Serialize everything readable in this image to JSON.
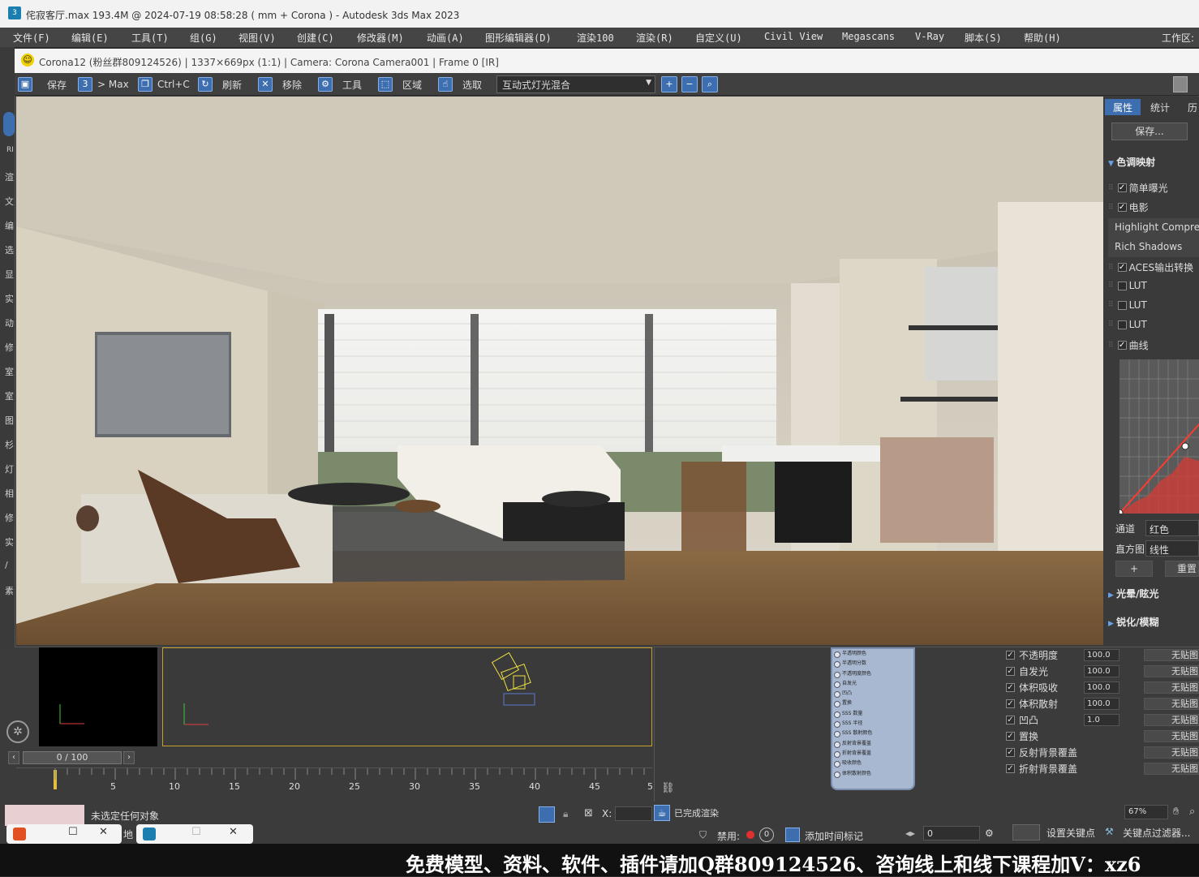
{
  "window": {
    "title": "侘寂客厅.max  193.4M @ 2024-07-19 08:58:28  ( mm + Corona ) - Autodesk 3ds Max 2023"
  },
  "menu": {
    "items": [
      "文件(F)",
      "编辑(E)",
      "工具(T)",
      "组(G)",
      "视图(V)",
      "创建(C)",
      "修改器(M)",
      "动画(A)",
      "图形编辑器(D)",
      "渲染100",
      "渲染(R)",
      "自定义(U)",
      "Civil View",
      "Megascans",
      "V-Ray",
      "脚本(S)",
      "帮助(H)"
    ],
    "workspace": "工作区:"
  },
  "left_strip": [
    "RI",
    "渲",
    "文",
    "编",
    "选",
    "显",
    "实",
    "动",
    "修",
    "室",
    "室",
    "图",
    "杉",
    "灯",
    "相",
    "修",
    "实",
    "/",
    "素"
  ],
  "vfb": {
    "title": "Corona12 (粉丝群809124526) | 1337×669px (1:1) | Camera: Corona Camera001 | Frame 0 [IR]",
    "toolbar": {
      "save": "保存",
      "to_max": "> Max",
      "copy": "Ctrl+C",
      "refresh": "刷新",
      "remove": "移除",
      "tools": "工具",
      "region": "区域",
      "pick": "选取",
      "mode_select": "互动式灯光混合"
    }
  },
  "right_panel": {
    "tabs": [
      "属性",
      "统计",
      "历"
    ],
    "save_button": "保存...",
    "tone_mapping": "色调映射",
    "simple_exposure": "简单曝光",
    "film": "电影",
    "highlight_compress": "Highlight Compre",
    "rich_shadows": "Rich Shadows",
    "aces": "ACES输出转换",
    "lut1": "LUT",
    "lut2": "LUT",
    "lut3": "LUT",
    "curves": "曲线",
    "channel_label": "通道",
    "channel_value": "红色",
    "histogram_label": "直方图",
    "histogram_value": "线性",
    "plus": "+",
    "reset": "重置",
    "bloom_glare": "光晕/眩光",
    "sharpen_blur": "锐化/模糊"
  },
  "material_node": {
    "slots": [
      "半透明颜色",
      "半透明分数",
      "不透明度颜色",
      "自发光",
      "凹凸",
      "置换",
      "SSS 数量",
      "SSS 半径",
      "SSS 散射颜色",
      "反射背景覆盖",
      "折射背景覆盖",
      "吸收颜色",
      "体积散射颜色"
    ]
  },
  "material_params": [
    {
      "name": "不透明度",
      "value": "100.0",
      "map": "无贴图"
    },
    {
      "name": "自发光",
      "value": "100.0",
      "map": "无贴图"
    },
    {
      "name": "体积吸收",
      "value": "100.0",
      "map": "无贴图"
    },
    {
      "name": "体积散射",
      "value": "100.0",
      "map": "无贴图"
    },
    {
      "name": "凹凸",
      "value": "1.0",
      "map": "无贴图"
    },
    {
      "name": "置换",
      "value": "",
      "map": "无贴图"
    },
    {
      "name": "反射背景覆盖",
      "value": "",
      "map": "无贴图"
    },
    {
      "name": "折射背景覆盖",
      "value": "",
      "map": "无贴图"
    }
  ],
  "timeline": {
    "frame_display": "0 / 100",
    "ticks": [
      "5",
      "10",
      "15",
      "20",
      "25",
      "30",
      "35",
      "40",
      "45",
      "5"
    ]
  },
  "status": {
    "selection": "未选定任何对象",
    "x_label": "X:",
    "render_done": "已完成渲染",
    "disable": "禁用:",
    "add_time_tag": "添加时间标记",
    "frame_value": "0",
    "set_key": "设置关键点",
    "key_filters": "关键点过滤器...",
    "zoom": "67%",
    "partial": "地"
  },
  "watermark": "免费模型、资料、软件、插件请加Q群809124526、咨询线上和线下课程加V：xz6",
  "colors": {
    "accent": "#3d6fb0",
    "frame_border": "#c8a030"
  }
}
